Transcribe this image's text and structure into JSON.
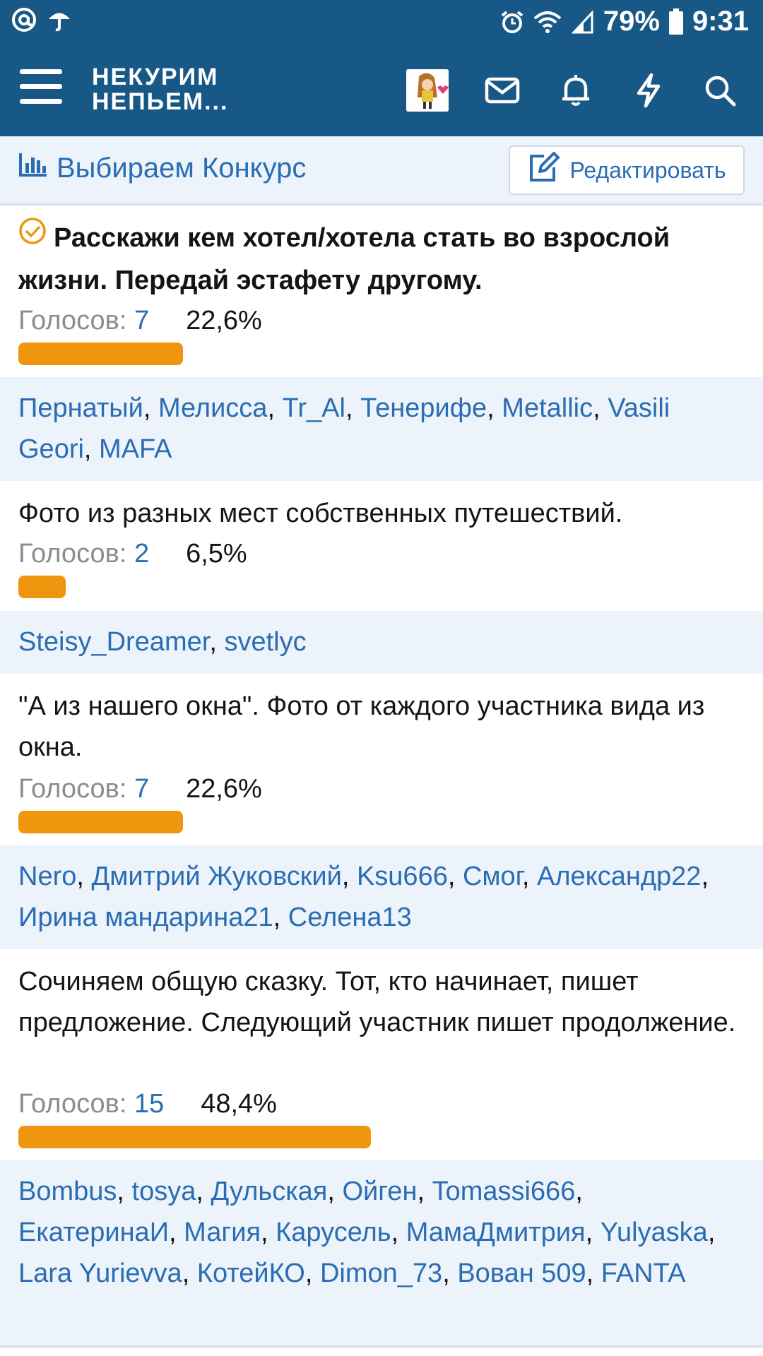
{
  "status_bar": {
    "battery_percent": "79%",
    "time": "9:31",
    "icons": [
      "at-icon",
      "umbrella-icon",
      "alarm-icon",
      "wifi-icon",
      "signal-icon",
      "battery-icon"
    ]
  },
  "header": {
    "logo_line1": "НЕКУРИМ",
    "logo_line2": "НЕПЬЕМ...",
    "icons": [
      "menu-icon",
      "avatar",
      "mail-icon",
      "bell-icon",
      "lightning-icon",
      "search-icon"
    ]
  },
  "poll": {
    "title": "Выбираем Конкурс",
    "edit_label": "Редактировать",
    "votes_label": "Голосов: ",
    "options": [
      {
        "text": "Расскажи кем хотел/хотела стать во взрослой жизни. Передай эстафету другому.",
        "votes": "7",
        "percent": "22,6%",
        "fraction": 0.226,
        "voted": true,
        "voters": [
          "Пернатый",
          "Мелисса",
          "Tr_Al",
          "Тенерифе",
          "Metallic",
          "Vasili Geori",
          "MAFA"
        ]
      },
      {
        "text": "Фото из разных мест собственных путешествий.",
        "votes": "2",
        "percent": "6,5%",
        "fraction": 0.065,
        "voted": false,
        "voters": [
          "Steisy_Dreamer",
          "svetlyc"
        ]
      },
      {
        "text": "\"А из нашего окна\". Фото от каждого участника вида из окна.",
        "votes": "7",
        "percent": "22,6%",
        "fraction": 0.226,
        "voted": false,
        "voters": [
          "Nero",
          "Дмитрий Жуковский",
          "Ksu666",
          "Смог",
          "Александр22",
          "Ирина мандарина21",
          "Селена13"
        ]
      },
      {
        "text": "Сочиняем общую сказку. Тот, кто начинает, пишет предложение. Следующий участник пишет продолжение.",
        "votes": "15",
        "percent": "48,4%",
        "fraction": 0.484,
        "voted": false,
        "voters": [
          "Bombus",
          "tosya",
          "Дульская",
          "Ойген",
          "Tomassi666",
          "ЕкатеринаИ",
          "Магия",
          "Карусель",
          "МамаДмитрия",
          "Yulyaska",
          "Lara Yurievva",
          "КотейКО",
          "Dimon_73",
          "Вован 509",
          "FANTA"
        ]
      }
    ]
  },
  "colors": {
    "header_bg": "#185886",
    "link": "#2a6db3",
    "bar": "#f0960e",
    "voters_bg": "#edf3fb",
    "check": "#f0960e"
  }
}
